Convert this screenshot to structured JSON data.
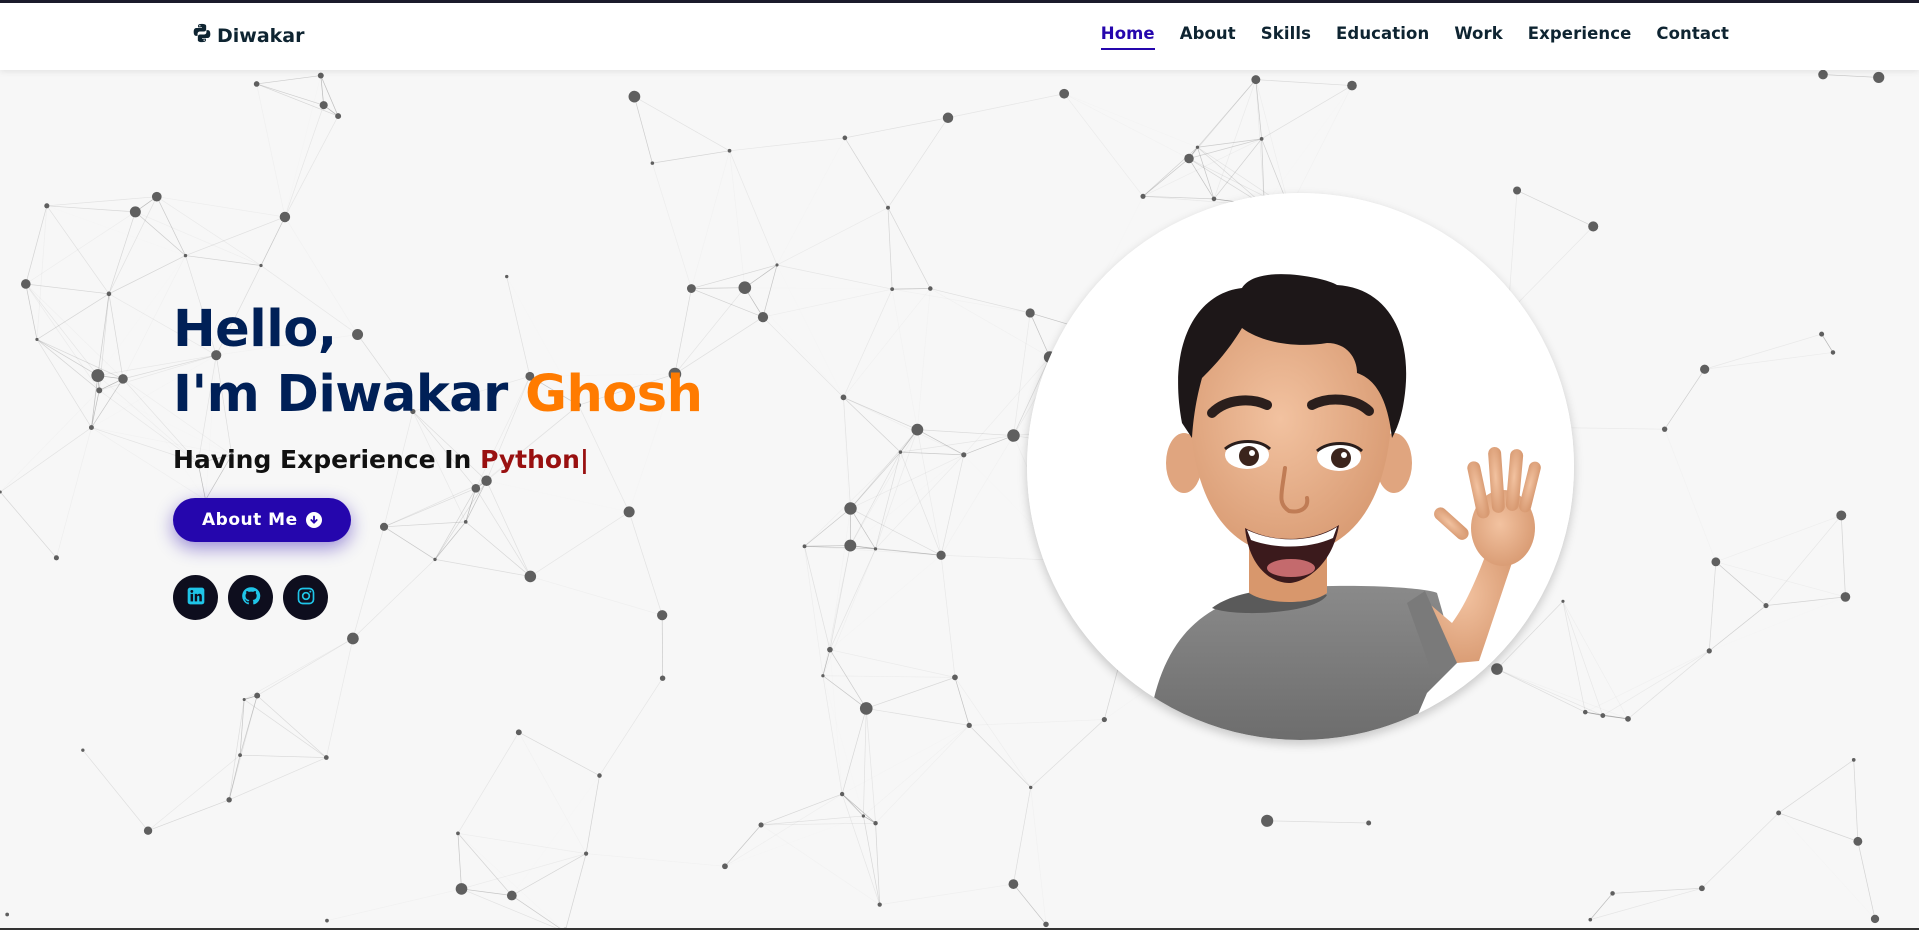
{
  "brand": {
    "name": "Diwakar",
    "icon": "python-logo-icon"
  },
  "nav": {
    "items": [
      {
        "label": "Home",
        "active": true
      },
      {
        "label": "About",
        "active": false
      },
      {
        "label": "Skills",
        "active": false
      },
      {
        "label": "Education",
        "active": false
      },
      {
        "label": "Work",
        "active": false
      },
      {
        "label": "Experience",
        "active": false
      },
      {
        "label": "Contact",
        "active": false
      }
    ]
  },
  "hero": {
    "greeting": "Hello,",
    "intro": "I'm Diwakar",
    "highlight": "Ghosh",
    "typed_prefix": "Having Experience In",
    "typed_role": "Python|",
    "button_label": "About Me",
    "button_icon": "arrow-circle-down-icon",
    "socials": [
      {
        "name": "linkedin-icon"
      },
      {
        "name": "github-icon"
      },
      {
        "name": "instagram-icon"
      }
    ]
  },
  "colors": {
    "primary": "#2506ad",
    "heading": "#002057",
    "highlight": "#ff7b00",
    "role": "#991010",
    "social_icon": "#1fc5e8",
    "background": "#f7f7f7"
  },
  "avatar": {
    "description_icon": "waving-cartoon-avatar"
  }
}
